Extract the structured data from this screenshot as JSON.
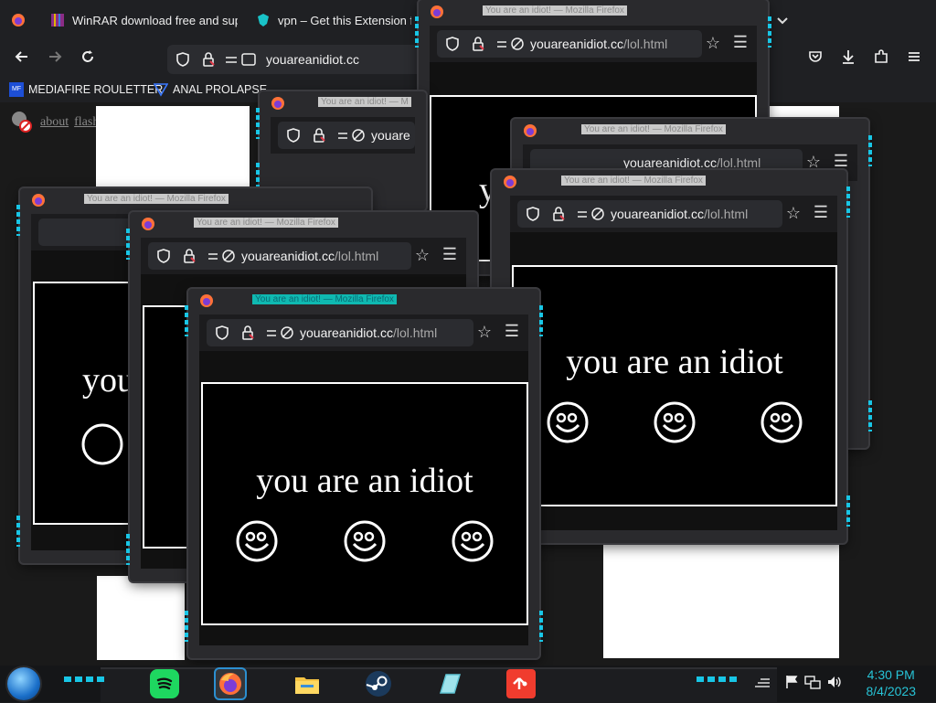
{
  "browser": {
    "tabs": [
      {
        "title": "WinRAR download free and sup",
        "close": "✕"
      },
      {
        "title": "vpn – Get this Extension for"
      }
    ],
    "url": "youareanidiot.cc",
    "bookmarks": [
      {
        "label": "MEDIAFIRE ROULETTER",
        "icon_text": "MF"
      },
      {
        "label": "ANAL PROLAPSE"
      }
    ]
  },
  "page": {
    "flash_links": [
      "about",
      "flash"
    ]
  },
  "popup": {
    "title": "You are an idiot! — Mozilla Firefox",
    "title_short": "You are an idiot! — M",
    "url_host": "youareanidiot.cc",
    "url_path": "/lol.html",
    "url_truncated": "youare",
    "message": "you are an idiot",
    "message_short": "you",
    "message_letter": "y"
  },
  "taskbar": {
    "time": "4:30 PM",
    "date": "8/4/2023"
  },
  "colors": {
    "accent_cyan": "#18c6e6",
    "active_title_bg": "#0fb9b1"
  },
  "icons": [
    "firefox-icon",
    "shield-icon",
    "lock-icon",
    "permissions-icon",
    "star-icon",
    "menu-icon",
    "smiley-icon",
    "spotify-icon",
    "file-explorer-icon",
    "steam-icon",
    "git-icon"
  ]
}
